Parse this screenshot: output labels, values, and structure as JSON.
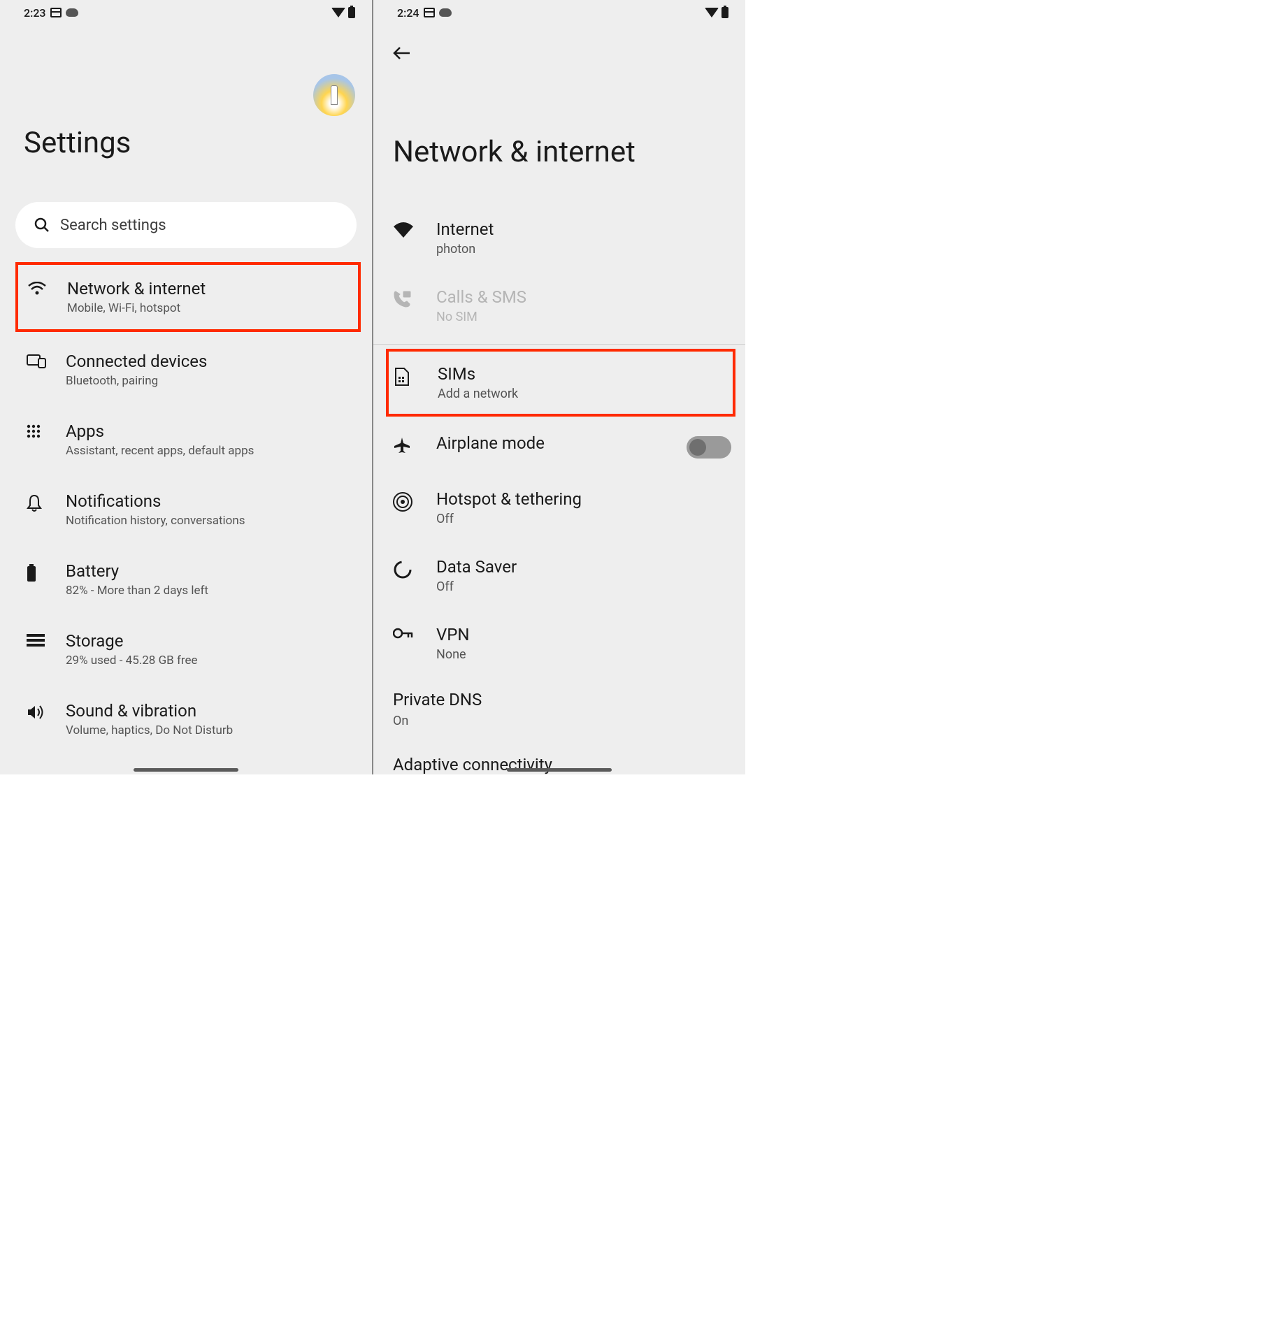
{
  "screen1": {
    "status": {
      "time": "2:23"
    },
    "title": "Settings",
    "search": {
      "placeholder": "Search settings"
    },
    "items": [
      {
        "icon": "wifi",
        "title": "Network & internet",
        "subtitle": "Mobile, Wi-Fi, hotspot",
        "highlight": true
      },
      {
        "icon": "devices",
        "title": "Connected devices",
        "subtitle": "Bluetooth, pairing"
      },
      {
        "icon": "apps",
        "title": "Apps",
        "subtitle": "Assistant, recent apps, default apps"
      },
      {
        "icon": "notifications",
        "title": "Notifications",
        "subtitle": "Notification history, conversations"
      },
      {
        "icon": "battery",
        "title": "Battery",
        "subtitle": "82% - More than 2 days left"
      },
      {
        "icon": "storage",
        "title": "Storage",
        "subtitle": "29% used - 45.28 GB free"
      },
      {
        "icon": "sound",
        "title": "Sound & vibration",
        "subtitle": "Volume, haptics, Do Not Disturb"
      }
    ]
  },
  "screen2": {
    "status": {
      "time": "2:24"
    },
    "title": "Network & internet",
    "items": [
      {
        "icon": "wifi-full",
        "title": "Internet",
        "subtitle": "photon"
      },
      {
        "icon": "phone",
        "title": "Calls & SMS",
        "subtitle": "No SIM",
        "disabled": true
      },
      {
        "icon": "sim",
        "title": "SIMs",
        "subtitle": "Add a network",
        "highlight": true
      },
      {
        "icon": "airplane",
        "title": "Airplane mode",
        "toggle": false
      },
      {
        "icon": "hotspot",
        "title": "Hotspot & tethering",
        "subtitle": "Off"
      },
      {
        "icon": "data-saver",
        "title": "Data Saver",
        "subtitle": "Off"
      },
      {
        "icon": "vpn",
        "title": "VPN",
        "subtitle": "None"
      }
    ],
    "private_dns": {
      "title": "Private DNS",
      "subtitle": "On"
    },
    "adaptive": {
      "title": "Adaptive connectivity"
    }
  }
}
